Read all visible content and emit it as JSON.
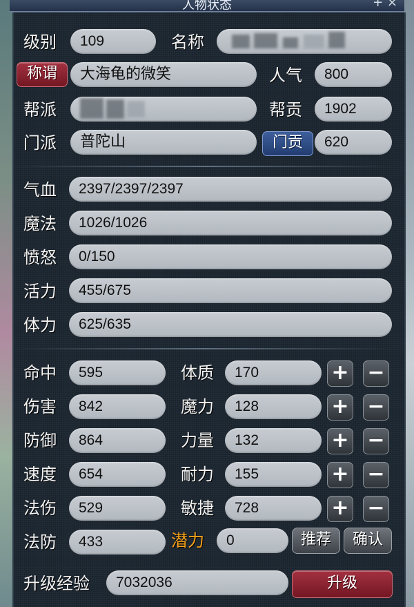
{
  "window": {
    "title": "人物状态",
    "controls": "+ ×"
  },
  "basic": {
    "level_label": "级别",
    "level": "109",
    "name_label": "名称",
    "title_button": "称谓",
    "title_value": "大海龟的微笑",
    "popularity_label": "人气",
    "popularity": "800",
    "gang_label": "帮派",
    "contribution_label": "帮贡",
    "contribution": "1902",
    "school_label": "门派",
    "school": "普陀山",
    "school_contrib_button": "门贡",
    "school_contrib": "620"
  },
  "vitals": [
    {
      "label": "气血",
      "value": "2397/2397/2397"
    },
    {
      "label": "魔法",
      "value": "1026/1026"
    },
    {
      "label": "愤怒",
      "value": "0/150"
    },
    {
      "label": "活力",
      "value": "455/675"
    },
    {
      "label": "体力",
      "value": "625/635"
    }
  ],
  "combat": [
    {
      "label": "命中",
      "value": "595"
    },
    {
      "label": "伤害",
      "value": "842"
    },
    {
      "label": "防御",
      "value": "864"
    },
    {
      "label": "速度",
      "value": "654"
    },
    {
      "label": "法伤",
      "value": "529"
    },
    {
      "label": "法防",
      "value": "433"
    }
  ],
  "attributes": [
    {
      "label": "体质",
      "value": "170"
    },
    {
      "label": "魔力",
      "value": "128"
    },
    {
      "label": "力量",
      "value": "132"
    },
    {
      "label": "耐力",
      "value": "155"
    },
    {
      "label": "敏捷",
      "value": "728"
    }
  ],
  "plus_glyph": "+",
  "minus_glyph": "−",
  "potential": {
    "label": "潜力",
    "value": "0",
    "recommend_button": "推荐",
    "confirm_button": "确认"
  },
  "exp": {
    "label": "升级经验",
    "value": "7032036",
    "upgrade_button": "升级"
  },
  "colors": {
    "accent_red": "#8a2230",
    "accent_blue": "#2f4e88",
    "potential_label": "#f7a21b",
    "field_bg": "#bcc1c7"
  }
}
